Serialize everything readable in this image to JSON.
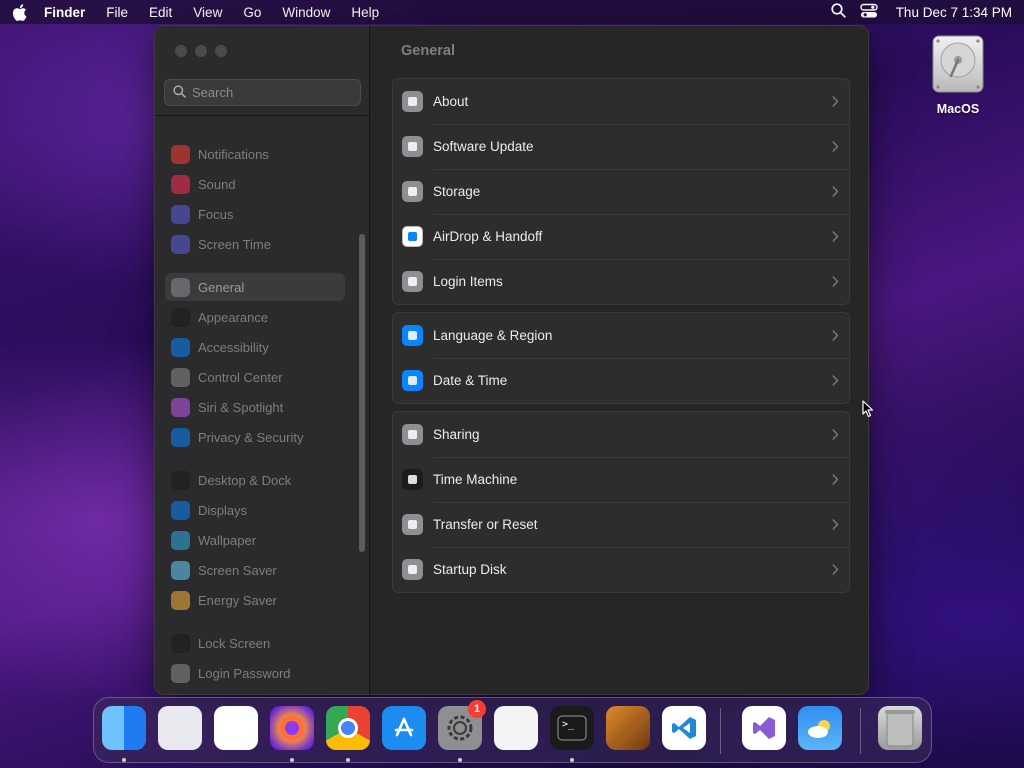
{
  "menubar": {
    "app_name": "Finder",
    "menus": [
      "File",
      "Edit",
      "View",
      "Go",
      "Window",
      "Help"
    ],
    "clock": "Thu Dec 7  1:34 PM"
  },
  "desktop": {
    "disk_label": "MacOS"
  },
  "sidebar": {
    "search_placeholder": "Search",
    "items": [
      {
        "label": "Notifications",
        "icon": "bell-icon",
        "color": "#ff3b30"
      },
      {
        "label": "Sound",
        "icon": "speaker-icon",
        "color": "#ff2d55"
      },
      {
        "label": "Focus",
        "icon": "moon-icon",
        "color": "#5e5ce6"
      },
      {
        "label": "Screen Time",
        "icon": "hourglass-icon",
        "color": "#5e5ce6"
      },
      {
        "label": "General",
        "icon": "gear-icon",
        "color": "#8e8e93",
        "selected": true
      },
      {
        "label": "Appearance",
        "icon": "appearance-icon",
        "color": "#1c1c1e"
      },
      {
        "label": "Accessibility",
        "icon": "accessibility-icon",
        "color": "#0a84ff"
      },
      {
        "label": "Control Center",
        "icon": "control-center-icon",
        "color": "#8e8e93"
      },
      {
        "label": "Siri & Spotlight",
        "icon": "siri-icon",
        "color": "#bf5af2"
      },
      {
        "label": "Privacy & Security",
        "icon": "hand-icon",
        "color": "#0a84ff"
      },
      {
        "label": "Desktop & Dock",
        "icon": "dock-icon",
        "color": "#1c1c1e"
      },
      {
        "label": "Displays",
        "icon": "sun-icon",
        "color": "#0a84ff"
      },
      {
        "label": "Wallpaper",
        "icon": "wallpaper-icon",
        "color": "#32ade6"
      },
      {
        "label": "Screen Saver",
        "icon": "screensaver-icon",
        "color": "#64d2ff"
      },
      {
        "label": "Energy Saver",
        "icon": "lightbulb-icon",
        "color": "#ffb340"
      },
      {
        "label": "Lock Screen",
        "icon": "lock-icon",
        "color": "#1c1c1e"
      },
      {
        "label": "Login Password",
        "icon": "password-icon",
        "color": "#8e8e93"
      }
    ]
  },
  "main": {
    "title": "General",
    "groups": [
      [
        {
          "label": "About",
          "icon": "display-icon",
          "color": "#8e8e93"
        },
        {
          "label": "Software Update",
          "icon": "gear-badge-icon",
          "color": "#8e8e93"
        },
        {
          "label": "Storage",
          "icon": "drive-icon",
          "color": "#8e8e93"
        },
        {
          "label": "AirDrop & Handoff",
          "icon": "airdrop-icon",
          "color": "#ffffff"
        },
        {
          "label": "Login Items",
          "icon": "list-icon",
          "color": "#8e8e93"
        }
      ],
      [
        {
          "label": "Language & Region",
          "icon": "globe-icon",
          "color": "#0a84ff"
        },
        {
          "label": "Date & Time",
          "icon": "calendar-clock-icon",
          "color": "#0a84ff"
        }
      ],
      [
        {
          "label": "Sharing",
          "icon": "sharing-icon",
          "color": "#8e8e93"
        },
        {
          "label": "Time Machine",
          "icon": "time-machine-icon",
          "color": "#1c1c1e"
        },
        {
          "label": "Transfer or Reset",
          "icon": "reset-icon",
          "color": "#8e8e93"
        },
        {
          "label": "Startup Disk",
          "icon": "startup-disk-icon",
          "color": "#8e8e93"
        }
      ]
    ]
  },
  "dock": {
    "apps": [
      {
        "name": "Finder",
        "icon": "finder-icon",
        "running": true
      },
      {
        "name": "Launchpad",
        "icon": "launchpad-icon",
        "running": false
      },
      {
        "name": "Safari",
        "icon": "safari-icon",
        "running": false
      },
      {
        "name": "Firefox",
        "icon": "firefox-icon",
        "running": true
      },
      {
        "name": "Chrome",
        "icon": "chrome-icon",
        "running": true
      },
      {
        "name": "App Store",
        "icon": "app-store-icon",
        "running": false
      },
      {
        "name": "System Settings",
        "icon": "system-settings-icon",
        "running": true,
        "badge": "1"
      },
      {
        "name": "TextEdit",
        "icon": "textedit-icon",
        "running": false
      },
      {
        "name": "Terminal",
        "icon": "terminal-icon",
        "running": true
      },
      {
        "name": "GarageBand",
        "icon": "garageband-icon",
        "running": false
      },
      {
        "name": "Visual Studio Code",
        "icon": "vscode-icon",
        "running": false
      },
      {
        "name": "Visual Studio",
        "icon": "visual-studio-icon",
        "running": false
      },
      {
        "name": "Weather",
        "icon": "weather-icon",
        "running": false
      },
      {
        "name": "Trash",
        "icon": "trash-icon",
        "running": false
      }
    ]
  }
}
